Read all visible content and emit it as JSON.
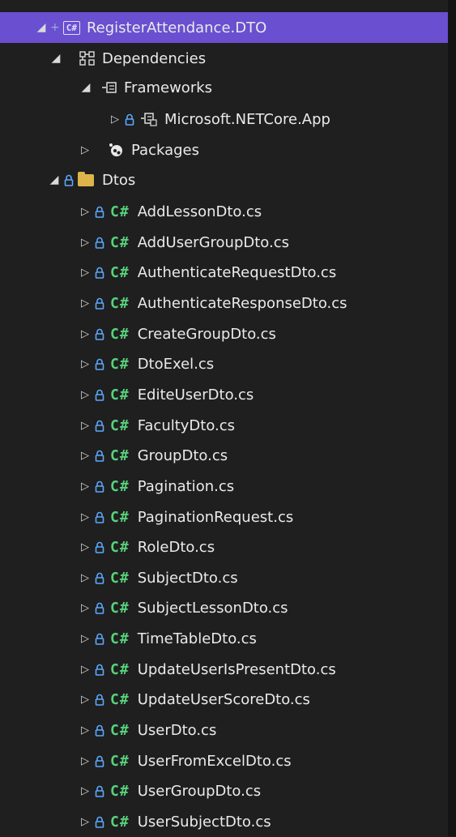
{
  "project": {
    "icon": "csharp-project-icon",
    "label": "RegisterAttendance.DTO",
    "plus": "+"
  },
  "dependencies": {
    "label": "Dependencies"
  },
  "frameworks": {
    "label": "Frameworks"
  },
  "netcore": {
    "label": "Microsoft.NETCore.App"
  },
  "packages": {
    "label": "Packages"
  },
  "dtos": {
    "label": "Dtos"
  },
  "files": [
    "AddLessonDto.cs",
    "AddUserGroupDto.cs",
    "AuthenticateRequestDto.cs",
    "AuthenticateResponseDto.cs",
    "CreateGroupDto.cs",
    "DtoExel.cs",
    "EditeUserDto.cs",
    "FacultyDto.cs",
    "GroupDto.cs",
    "Pagination.cs",
    "PaginationRequest.cs",
    "RoleDto.cs",
    "SubjectDto.cs",
    "SubjectLessonDto.cs",
    "TimeTableDto.cs",
    "UpdateUserIsPresentDto.cs",
    "UpdateUserScoreDto.cs",
    "UserDto.cs",
    "UserFromExcelDto.cs",
    "UserGroupDto.cs",
    "UserSubjectDto.cs"
  ],
  "cs_glyph": "C#",
  "colors": {
    "background": "#1f1f1f",
    "selection": "#6a4fd0",
    "csharp": "#57d27b",
    "folder": "#dcb44a",
    "lock": "#5aa9ff"
  }
}
